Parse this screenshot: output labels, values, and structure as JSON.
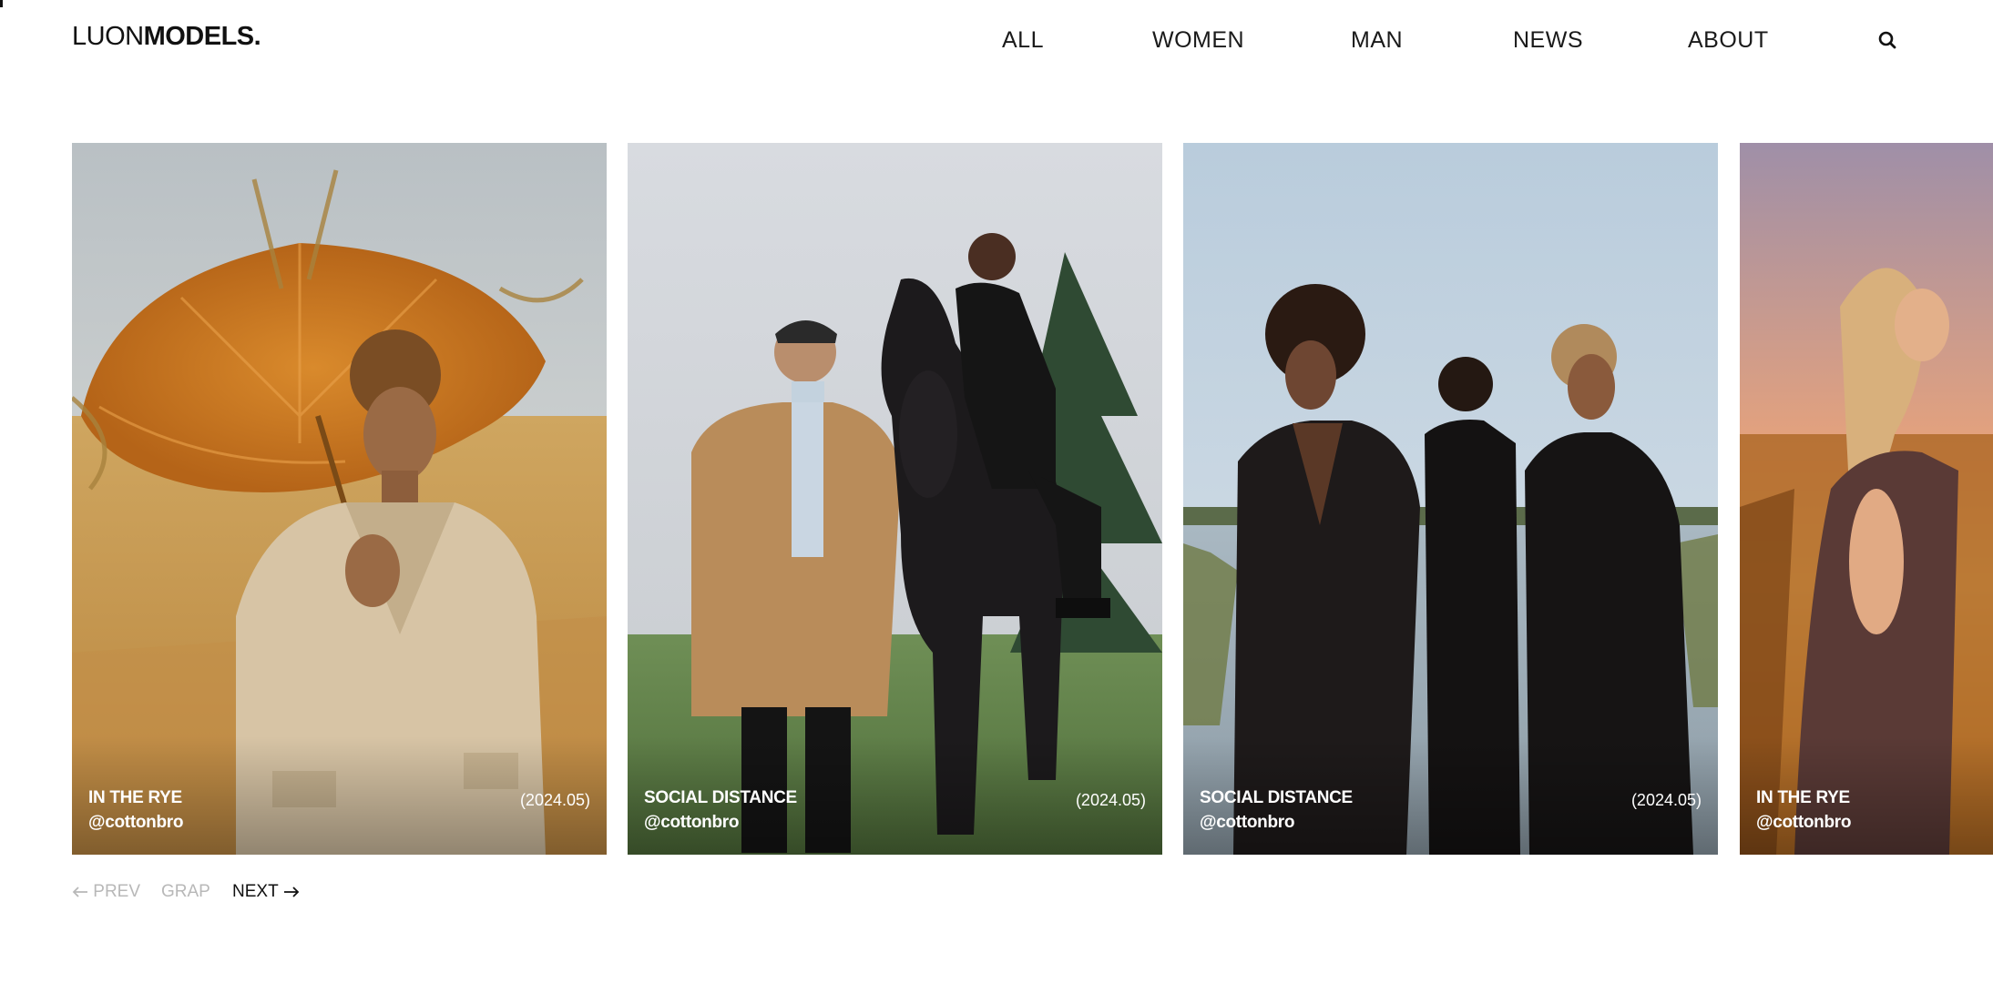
{
  "brand": {
    "light": "LUON",
    "bold": "MODELS."
  },
  "nav": {
    "items": [
      {
        "label": "ALL"
      },
      {
        "label": "WOMEN"
      },
      {
        "label": "MAN"
      },
      {
        "label": "NEWS"
      },
      {
        "label": "ABOUT"
      }
    ],
    "search_icon": "search-icon"
  },
  "cards": [
    {
      "title": "IN THE RYE",
      "handle": "@cottonbro",
      "date": "(2024.05)"
    },
    {
      "title": "SOCIAL DISTANCE",
      "handle": "@cottonbro",
      "date": "(2024.05)"
    },
    {
      "title": "SOCIAL DISTANCE",
      "handle": "@cottonbro",
      "date": "(2024.05)"
    },
    {
      "title": "IN THE RYE",
      "handle": "@cottonbro",
      "date": ""
    }
  ],
  "pager": {
    "prev": "PREV",
    "grap": "GRAP",
    "next": "NEXT"
  },
  "colors": {
    "text": "#111111",
    "muted": "#b8b8b8",
    "background": "#ffffff"
  }
}
